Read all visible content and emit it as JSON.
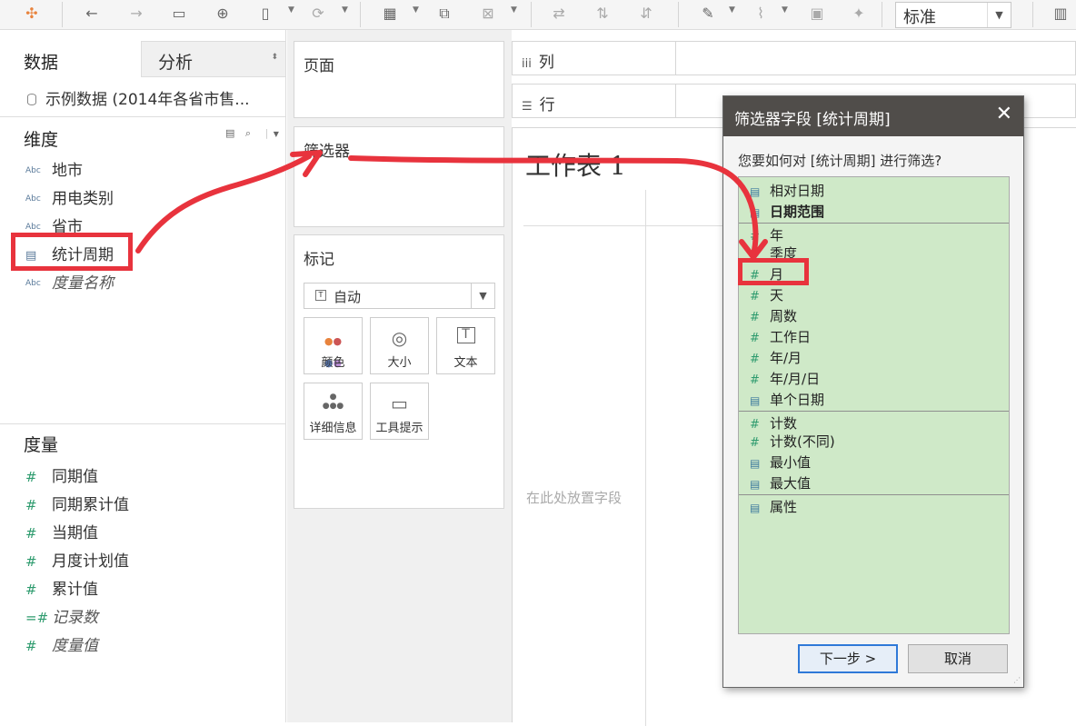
{
  "toolbar": {
    "view_mode_value": "标准",
    "icons": [
      "tableau-logo-icon",
      "undo-icon",
      "redo-icon",
      "save-icon",
      "new-datasource-icon",
      "pause-update-icon",
      "refresh-icon",
      "new-worksheet-icon",
      "duplicate-icon",
      "clear-icon",
      "swap-icon",
      "sort-asc-icon",
      "sort-desc-icon",
      "highlight-icon",
      "group-icon",
      "label-icon",
      "pin-icon",
      "show-me-icon"
    ]
  },
  "left_panel": {
    "tab_data": "数据",
    "tab_analysis": "分析",
    "datasource_name": "示例数据 (2014年各省市售...",
    "dimensions_title": "维度",
    "dimensions": [
      {
        "label": "地市",
        "icon": "Abc"
      },
      {
        "label": "用电类别",
        "icon": "Abc"
      },
      {
        "label": "省市",
        "icon": "Abc"
      },
      {
        "label": "统计周期",
        "icon": "calendar"
      },
      {
        "label": "度量名称",
        "icon": "Abc"
      }
    ],
    "measures_title": "度量",
    "measures": [
      {
        "label": "同期值"
      },
      {
        "label": "同期累计值"
      },
      {
        "label": "当期值"
      },
      {
        "label": "月度计划值"
      },
      {
        "label": "累计值"
      },
      {
        "label": "记录数"
      },
      {
        "label": "度量值"
      }
    ]
  },
  "shelves": {
    "pages": "页面",
    "filters": "筛选器",
    "marks": "标记",
    "marks_type": "自动",
    "mark_buttons": [
      {
        "label": "颜色"
      },
      {
        "label": "大小"
      },
      {
        "label": "文本"
      },
      {
        "label": "详细信息"
      },
      {
        "label": "工具提示"
      }
    ],
    "columns": "列",
    "rows": "行"
  },
  "sheet": {
    "title": "工作表 1",
    "drop_hint": "在此处放置字段"
  },
  "dialog": {
    "title": "筛选器字段 [统计周期]",
    "question": "您要如何对 [统计周期] 进行筛选?",
    "options": [
      {
        "label": "相对日期",
        "icon": "calendar"
      },
      {
        "label": "日期范围",
        "icon": "calendar",
        "bold": true
      },
      {
        "label": "年",
        "icon": "hash"
      },
      {
        "label": "季度",
        "icon": "hash"
      },
      {
        "label": "月",
        "icon": "hash"
      },
      {
        "label": "天",
        "icon": "hash"
      },
      {
        "label": "周数",
        "icon": "hash"
      },
      {
        "label": "工作日",
        "icon": "hash"
      },
      {
        "label": "年/月",
        "icon": "hash"
      },
      {
        "label": "年/月/日",
        "icon": "hash"
      },
      {
        "label": "单个日期",
        "icon": "calendar"
      },
      {
        "label": "计数",
        "icon": "hash"
      },
      {
        "label": "计数(不同)",
        "icon": "hash"
      },
      {
        "label": "最小值",
        "icon": "calendar"
      },
      {
        "label": "最大值",
        "icon": "calendar"
      },
      {
        "label": "属性",
        "icon": "calendar"
      }
    ],
    "next_button": "下一步 >",
    "cancel_button": "取消"
  },
  "colors": {
    "annotation": "#e8333d",
    "dialog_titlebar": "#504d4a",
    "list_bg": "#cfe9c8",
    "primary_border": "#2f79d8"
  }
}
